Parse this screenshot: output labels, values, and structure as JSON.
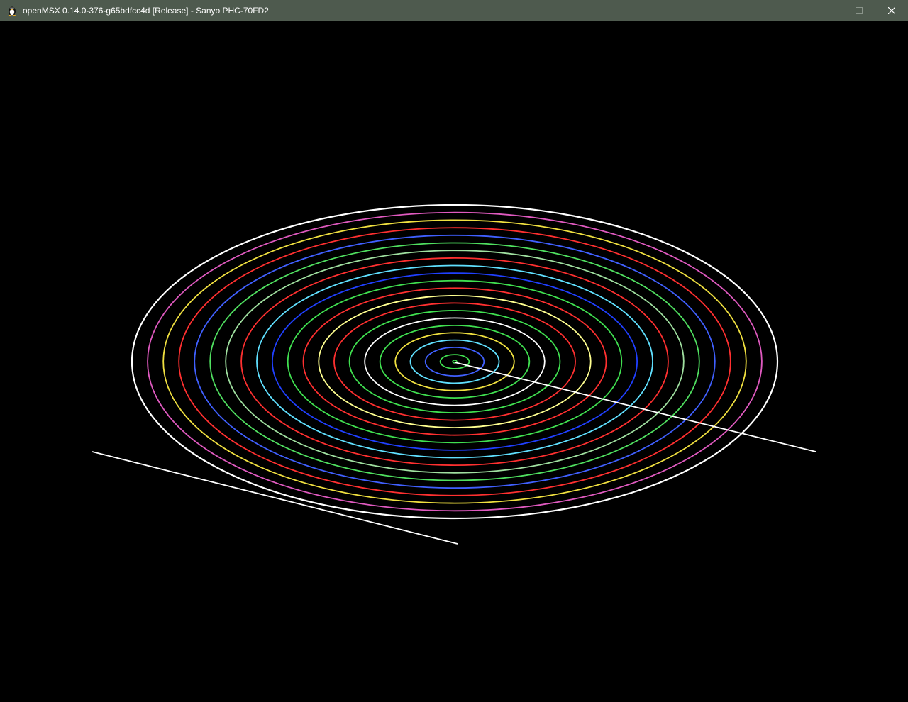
{
  "window": {
    "title": "openMSX 0.14.0-376-g65bdfcc4d [Release] - Sanyo PHC-70FD2",
    "app_icon": "tux-penguin-icon",
    "controls": {
      "minimize_icon": "minimize-icon",
      "maximize_icon": "maximize-icon",
      "close_icon": "close-icon",
      "maximize_enabled": false
    }
  },
  "screen": {
    "background": "#000000",
    "ring_colors": [
      "#ffffff",
      "#e05ac0",
      "#f0e040",
      "#ff3030",
      "#4060ff",
      "#50e060",
      "#a0e0a0",
      "#ff3030",
      "#60e0ff",
      "#2040ff",
      "#40e050",
      "#ff3030",
      "#ffff90",
      "#ff3030",
      "#40e050",
      "#ffffff",
      "#40e050",
      "#f0e040",
      "#60e0ff",
      "#4060ff",
      "#40e050"
    ]
  }
}
